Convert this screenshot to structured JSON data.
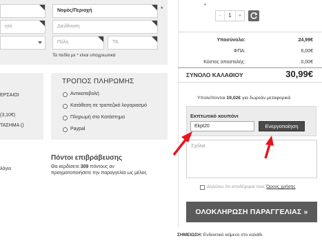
{
  "address_form": {
    "row1_left_value": "",
    "region_select": "Νομός/Περιοχή",
    "required_mark": "*",
    "row2_left_placeholder": "ητό",
    "address_placeholder": "Διεύθυνση",
    "city_placeholder": "Πόλη",
    "zip_placeholder": "ΤΚ",
    "required_note": "Τα πεδία με * είναι υποχρεωτικά"
  },
  "shipping_partial": {
    "line1": "ΕΡΣΑΙΟΙ",
    "line2": "(3,10€)",
    "line3": "ΤΑΣΗΜΑ ()"
  },
  "payment": {
    "title": "ΤΡΟΠΟΣ ΠΛΗΡΩΜΗΣ",
    "options": [
      "Αντικαταβολή",
      "Κατάθεση σε τραπεζικό λογαριασμό",
      "Πληρωμή στο Κατάστημα",
      "Paypal"
    ]
  },
  "loyalty": {
    "left_fragment": "λόγιο",
    "title": "Πόντοι επιβράβευσης",
    "text_before": "Θα κερδίσετε ",
    "points": "309",
    "text_after": " πόντους αν",
    "text_line2": "πραγματοποιήσετε την παραγγελία ως μέλος"
  },
  "cart": {
    "qty_minus": "-",
    "qty_value": "1",
    "qty_plus": "+",
    "subtotal_label": "Υποσύνολο:",
    "subtotal_value": "24,99€",
    "vat_label": "ΦΠΑ:",
    "vat_value": "6,00€",
    "shipping_label": "Κόστος αποστολής:",
    "shipping_value": "0,00€",
    "total_label": "ΣΥΝΟΛΟ ΚΑΛΑΘΙΟΥ",
    "total_value": "30,99€",
    "free_ship_before": "Υπολείπονται ",
    "free_ship_amount": "19,02€",
    "free_ship_after": " για δωρεάν μεταφορικά"
  },
  "coupon": {
    "title": "Εκπτωτικό κουπόνι",
    "value": "Ekpt20",
    "apply_label": "Ενεργοποίηση"
  },
  "comments": {
    "placeholder": "Σχόλια"
  },
  "terms": {
    "text": "Δηλώνω ότι αποδέχομαι τους ",
    "link": "Όρους χρήσης"
  },
  "checkout": {
    "label": "ΟΛΟΚΛΗΡΩΣΗ ΠΑΡΑΓΓΕΛΙΑΣ »"
  },
  "note": {
    "label": "ΣΗΜΕΙΩΣΗ:",
    "text": " Ενδεικτικό κείμενο στο καλάθι."
  },
  "colors": {
    "annotation_arrow": "#e8141c",
    "panel_bg": "#efefef",
    "button_dark": "#5b5b5b"
  }
}
